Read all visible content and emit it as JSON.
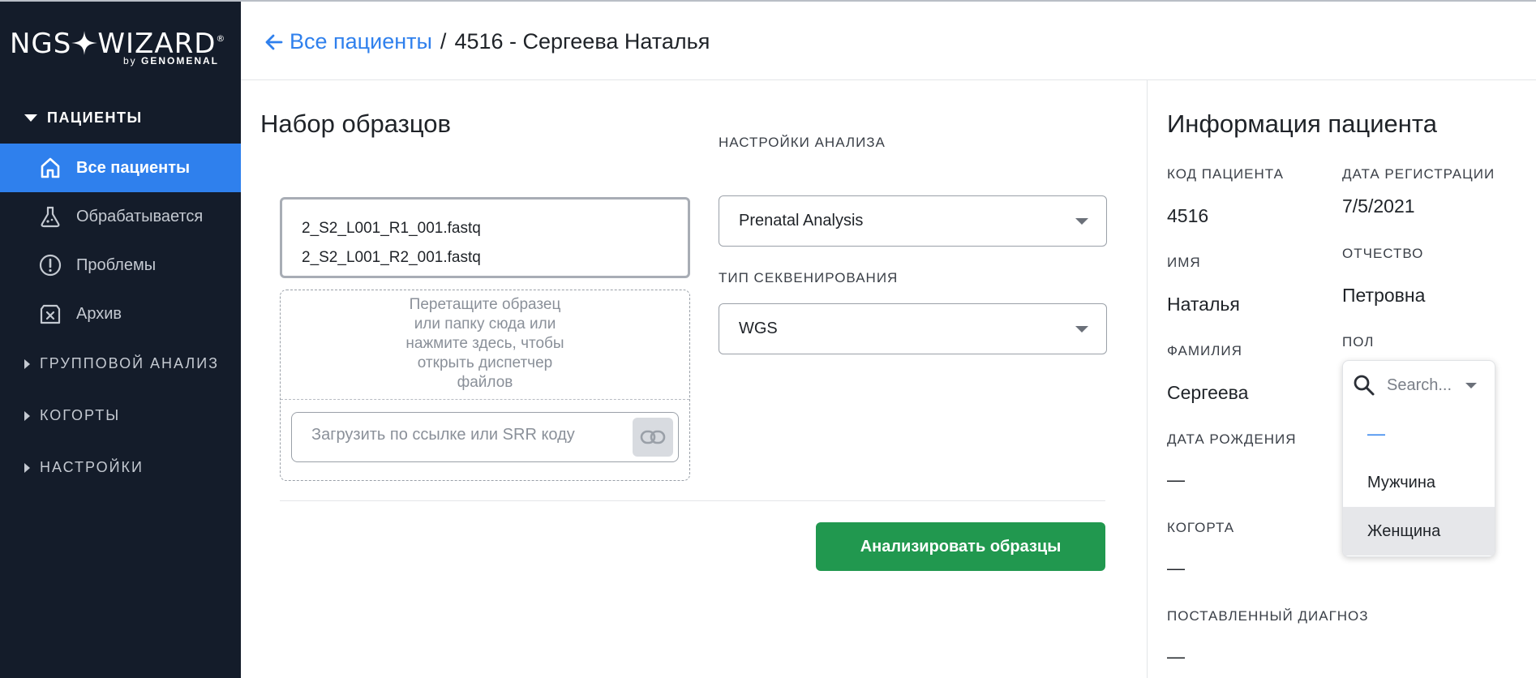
{
  "brand": {
    "name_left": "NGS",
    "name_right": "WIZARD",
    "registered": "®",
    "by": "by",
    "company": "GENOMENAL"
  },
  "sidebar": {
    "patients_section": "ПАЦИЕНТЫ",
    "items": [
      {
        "label": "Все пациенты",
        "icon": "home-icon",
        "active": true
      },
      {
        "label": "Обрабатывается",
        "icon": "flask-icon",
        "active": false
      },
      {
        "label": "Проблемы",
        "icon": "alert-circle-icon",
        "active": false
      },
      {
        "label": "Архив",
        "icon": "archive-icon",
        "active": false
      }
    ],
    "group_analysis": "ГРУППОВОЙ АНАЛИЗ",
    "cohorts": "КОГОРТЫ",
    "settings": "НАСТРОЙКИ"
  },
  "header": {
    "back_link": "Все пациенты",
    "separator": "/",
    "current": "4516 - Сергеева Наталья"
  },
  "samples": {
    "title": "Набор образцов",
    "files": [
      "2_S2_L001_R1_001.fastq",
      "2_S2_L001_R2_001.fastq"
    ],
    "drop_lines": [
      "Перетащите образец",
      "или папку сюда или",
      "нажмите здесь, чтобы",
      "открыть диспетчер",
      "файлов"
    ],
    "url_placeholder": "Загрузить по ссылке или SRR коду"
  },
  "analysis": {
    "settings_label": "НАСТРОЙКИ АНАЛИЗА",
    "settings_value": "Prenatal Analysis",
    "seq_type_label": "ТИП СЕКВЕНИРОВАНИЯ",
    "seq_type_value": "WGS",
    "submit_label": "Анализировать образцы"
  },
  "patient": {
    "title": "Информация пациента",
    "code_label": "КОД ПАЦИЕНТА",
    "code_value": "4516",
    "reg_date_label": "ДАТА РЕГИСТРАЦИИ",
    "reg_date_value": "7/5/2021",
    "first_name_label": "ИМЯ",
    "first_name_value": "Наталья",
    "patronymic_label": "ОТЧЕСТВО",
    "patronymic_value": "Петровна",
    "last_name_label": "ФАМИЛИЯ",
    "last_name_value": "Сергеева",
    "sex_label": "ПОЛ",
    "birth_date_label": "ДАТА РОЖДЕНИЯ",
    "birth_date_value": "—",
    "cohort_label": "КОГОРТА",
    "cohort_value": "—",
    "diagnosis_label": "ПОСТАВЛЕННЫЙ ДИАГНОЗ",
    "diagnosis_value": "—"
  },
  "sex_dropdown": {
    "placeholder": "Search...",
    "options": [
      "—",
      "Мужчина",
      "Женщина"
    ],
    "highlighted": "Женщина"
  },
  "colors": {
    "sidebar_bg": "#141c2a",
    "accent": "#2f80ed",
    "primary_button": "#21984f"
  }
}
